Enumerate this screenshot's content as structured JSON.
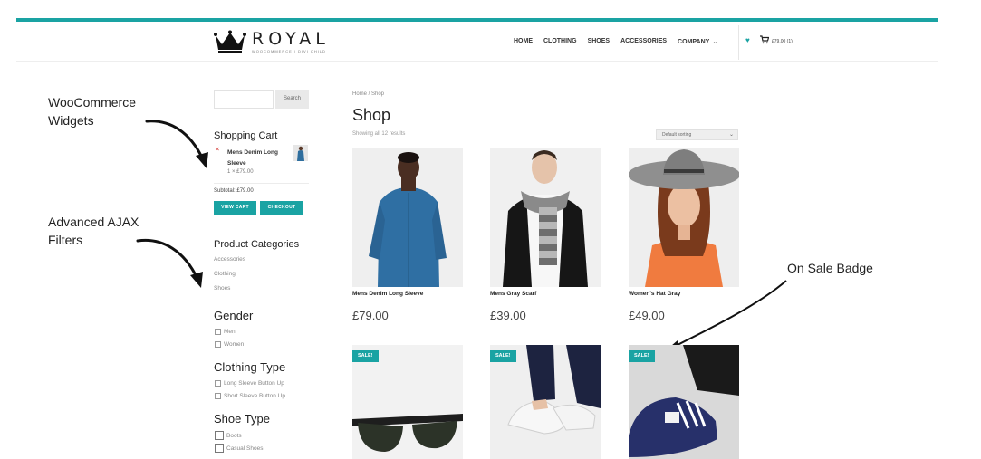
{
  "logo": {
    "name": "ROYAL",
    "subtitle": "WOOCOMMERCE | DIVI CHILD"
  },
  "nav": {
    "items": [
      "HOME",
      "CLOTHING",
      "SHOES",
      "ACCESSORIES",
      "COMPANY"
    ],
    "cart_total": "£79.00 (1)"
  },
  "annotations": {
    "widgets_line1": "WooCommerce",
    "widgets_line2": "Widgets",
    "filters_line1": "Advanced AJAX",
    "filters_line2": "Filters",
    "sale_badge": "On Sale Badge"
  },
  "sidebar": {
    "search_placeholder": "",
    "search_button": "Search",
    "cart": {
      "title": "Shopping Cart",
      "remove_symbol": "×",
      "item_name": "Mens Denim Long Sleeve",
      "item_qty": "1 × £79.00",
      "subtotal": "Subtotal: £79.00",
      "view_cart": "VIEW CART",
      "checkout": "CHECKOUT"
    },
    "categories": {
      "title": "Product Categories",
      "items": [
        "Accessories",
        "Clothing",
        "Shoes"
      ]
    },
    "gender": {
      "title": "Gender",
      "options": [
        "Men",
        "Women"
      ]
    },
    "clothing_type": {
      "title": "Clothing Type",
      "options": [
        "Long Sleeve Button Up",
        "Short Sleeve Button Up"
      ]
    },
    "shoe_type": {
      "title": "Shoe Type",
      "options": [
        "Boots",
        "Casual Shoes"
      ]
    }
  },
  "main": {
    "breadcrumb": "Home / Shop",
    "title": "Shop",
    "result_count": "Showing all 12 results",
    "sort_selected": "Default sorting",
    "sale_label": "SALE!",
    "products": [
      {
        "name": "Mens Denim Long Sleeve",
        "price": "£79.00"
      },
      {
        "name": "Mens Gray Scarf",
        "price": "£39.00"
      },
      {
        "name": "Women's Hat Gray",
        "price": "£49.00"
      }
    ]
  },
  "colors": {
    "accent": "#1aa3a3",
    "remove": "#d9534f"
  }
}
